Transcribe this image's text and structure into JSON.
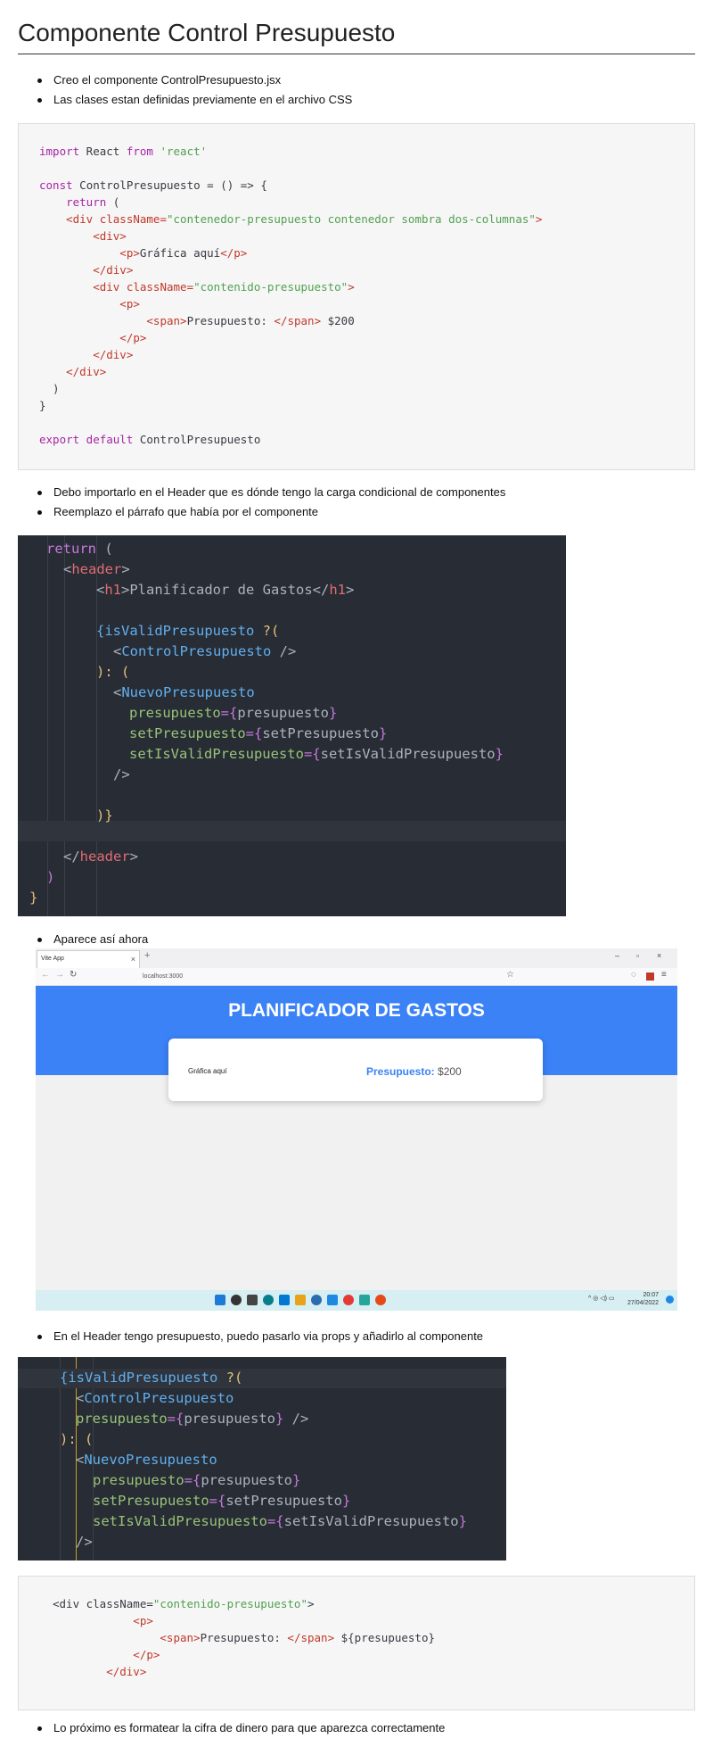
{
  "title": "Componente Control Presupuesto",
  "bullets1": [
    "Creo el componente ControlPresupuesto.jsx",
    "Las clases estan definidas previamente en el archivo CSS"
  ],
  "code1": {
    "l1_import": "import",
    "l1_react": " React ",
    "l1_from": "from",
    "l1_str": "'react'",
    "l3_const": "const",
    "l3_rest": " ControlPresupuesto = () => {",
    "l4_return": "    return",
    "l4_paren": " (",
    "l5_open": "    <div className=",
    "l5_str": "\"contenedor-presupuesto contenedor sombra dos-columnas\"",
    "l5_close": ">",
    "l6": "        <div>",
    "l7_open": "            <p>",
    "l7_text": "Gráfica aquí",
    "l7_close": "</p>",
    "l8": "        </div>",
    "l9_open": "        <div className=",
    "l9_str": "\"contenido-presupuesto\"",
    "l9_close": ">",
    "l10": "            <p>",
    "l11_open": "                <span>",
    "l11_text": "Presupuesto: ",
    "l11_close": "</span>",
    "l11_val": " $200",
    "l12": "            </p>",
    "l13": "        </div>",
    "l14": "    </div>",
    "l15": "  )",
    "l16": "}",
    "l18_export": "export default",
    "l18_name": " ControlPresupuesto"
  },
  "bullets2": [
    "Debo importarlo en el Header que es dónde tengo la carga condicional de componentes",
    "Reemplazo el párrafo que había por el componente"
  ],
  "dark1": {
    "return": "return",
    "paren": " (",
    "header_open_lt": "<",
    "header_tag": "header",
    "gt": ">",
    "h1_open": "<",
    "h1_tag": "h1",
    "h1_text": ">Planificador de Gastos</",
    "h1_tag2": "h1",
    "h1_end": ">",
    "cond": "{isValidPresupuesto ",
    "q": "?(",
    "cp_lt": "<",
    "cp_name": "ControlPresupuesto",
    "cp_end": " />",
    "else": "): (",
    "np_lt": "<",
    "np_name": "NuevoPresupuesto",
    "p1_attr": "presupuesto",
    "p1_eq": "={",
    "p1_val": "presupuesto",
    "p1_end": "}",
    "p2_attr": "setPresupuesto",
    "p2_eq": "={",
    "p2_val": "setPresupuesto",
    "p2_end": "}",
    "p3_attr": "setIsValidPresupuesto",
    "p3_eq": "={",
    "p3_val": "setIsValidPresupuesto",
    "p3_end": "}",
    "selfclose": "/>",
    "close_cond": ")}",
    "header_close": "</",
    "header_tag2": "header",
    "paren_close": ")",
    "brace_close": "}"
  },
  "bullet3": "Aparece así ahora",
  "browser": {
    "tab_title": "Vite App",
    "tab_close": "×",
    "new_tab": "+",
    "min": "–",
    "max": "▫",
    "close": "×",
    "back": "←",
    "forward": "→",
    "reload": "↻",
    "url": "localhost:3000",
    "heading": "PLANIFICADOR DE GASTOS",
    "grafica": "Gráfica aquí",
    "presupuesto_label": "Presupuesto:",
    "presupuesto_value": " $200",
    "time": "20:07",
    "date": "27/04/2022",
    "tray": "^  ◎ ◁) ▭"
  },
  "bullet4": "En el Header tengo presupuesto, puedo pasarlo via props y añadirlo al componente",
  "dark2": {
    "cond": "{isValidPresupuesto ",
    "q": "?(",
    "cp_lt": "<",
    "cp_name": "ControlPresupuesto",
    "cp_attr": "presupuesto",
    "cp_eq": "={",
    "cp_val": "presupuesto",
    "cp_end": "}",
    "cp_close": " />",
    "else": "): (",
    "np_lt": "<",
    "np_name": "NuevoPresupuesto",
    "p1_attr": "presupuesto",
    "p1_eq": "={",
    "p1_val": "presupuesto",
    "p1_end": "}",
    "p2_attr": "setPresupuesto",
    "p2_eq": "={",
    "p2_val": "setPresupuesto",
    "p2_end": "}",
    "p3_attr": "setIsValidPresupuesto",
    "p3_eq": "={",
    "p3_val": "setIsValidPresupuesto",
    "p3_end": "}",
    "selfclose": "/>"
  },
  "code2": {
    "l1_open": "<div className=",
    "l1_str": "\"contenido-presupuesto\"",
    "l1_close": ">",
    "l2": "            <p>",
    "l3_open": "                <span>",
    "l3_text": "Presupuesto: ",
    "l3_close": "</span>",
    "l3_val": " ${presupuesto}",
    "l4": "            </p>",
    "l5": "        </div>"
  },
  "bullet5": "Lo próximo es formatear la cifra de dinero para que aparezca correctamente"
}
